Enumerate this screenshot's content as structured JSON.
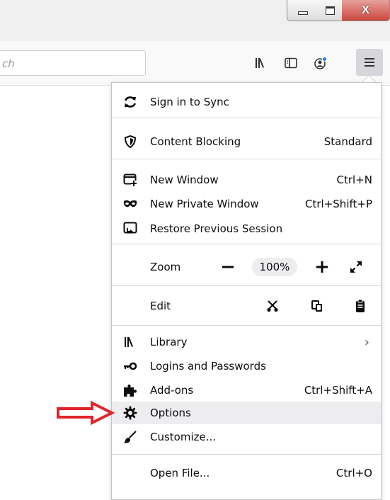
{
  "window": {
    "minimize_icon": "minimize-icon",
    "maximize_icon": "maximize-icon",
    "close_label": "X"
  },
  "toolbar": {
    "search_partial": "ch",
    "library_icon": "library-icon",
    "sidebar_icon": "sidebar-icon",
    "account_icon": "account-icon",
    "menu_icon": "hamburger-icon"
  },
  "menu": {
    "sync": "Sign in to Sync",
    "content_blocking": {
      "label": "Content Blocking",
      "value": "Standard"
    },
    "new_window": {
      "label": "New Window",
      "shortcut": "Ctrl+N"
    },
    "new_private_window": {
      "label": "New Private Window",
      "shortcut": "Ctrl+Shift+P"
    },
    "restore_session": "Restore Previous Session",
    "zoom": {
      "label": "Zoom",
      "minus": "−",
      "value": "100%",
      "plus": "+"
    },
    "edit": {
      "label": "Edit"
    },
    "library": {
      "label": "Library",
      "chevron": "›"
    },
    "logins": "Logins and Passwords",
    "addons": {
      "label": "Add-ons",
      "shortcut": "Ctrl+Shift+A"
    },
    "options": "Options",
    "customize": "Customize...",
    "open_file": {
      "label": "Open File...",
      "shortcut": "Ctrl+O"
    }
  },
  "colors": {
    "annotation_arrow": "#e0252b",
    "menu_highlight": "#ededf0",
    "notification_dot": "#0a84ff"
  }
}
